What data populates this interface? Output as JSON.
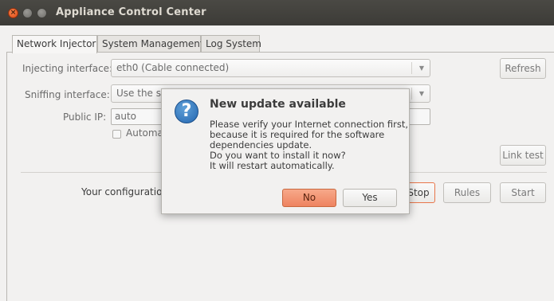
{
  "window": {
    "title": "Appliance Control Center"
  },
  "tabs": [
    {
      "label": "Network Injector",
      "active": true
    },
    {
      "label": "System Management",
      "active": false
    },
    {
      "label": "Log System",
      "active": false
    }
  ],
  "form": {
    "injecting_label": "Injecting interface:",
    "injecting_value": "eth0 (Cable connected)",
    "sniffing_label": "Sniffing interface:",
    "sniffing_value": "Use the sa",
    "public_ip_label": "Public IP:",
    "public_ip_value": "auto",
    "auto_checkbox_label": "Automat",
    "refresh_button": "Refresh",
    "link_test_button": "Link test",
    "config_label": "Your configuration",
    "stop_button": "Stop",
    "rules_button": "Rules",
    "start_button": "Start"
  },
  "dialog": {
    "title": "New update available",
    "message_lines": [
      "Please verify your Internet connection first,",
      "because it is required for the software",
      "dependencies update.",
      "Do you want to install it now?",
      "It will restart automatically."
    ],
    "no_button": "No",
    "yes_button": "Yes",
    "icon": "question-icon"
  },
  "colors": {
    "titlebar": "#3c3b37",
    "accent_orange": "#ee8360",
    "question_blue": "#2466b0"
  }
}
